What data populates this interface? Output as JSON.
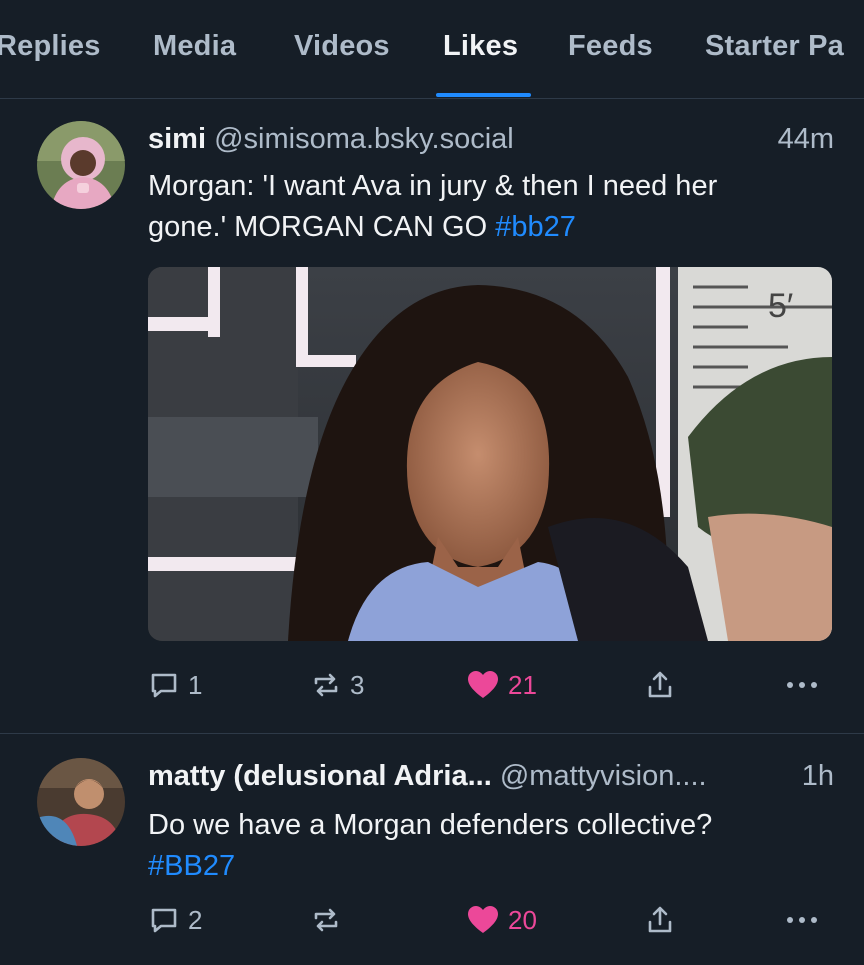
{
  "tabs": [
    {
      "label": "Replies"
    },
    {
      "label": "Media"
    },
    {
      "label": "Videos"
    },
    {
      "label": "Likes",
      "active": true
    },
    {
      "label": "Feeds"
    },
    {
      "label": "Starter Pa"
    }
  ],
  "posts": [
    {
      "display_name": "simi",
      "handle": "@simisoma.bsky.social",
      "time": "44m",
      "text_line1": "Morgan: 'I want Ava in jury & then I need her",
      "text_line2": "gone.' MORGAN CAN GO ",
      "hashtag": "#bb27",
      "has_image": true,
      "replies": "1",
      "reposts": "3",
      "likes": "21",
      "liked": true
    },
    {
      "display_name": "matty (delusional Adria...",
      "handle": "@mattyvision....",
      "time": "1h",
      "text_line1": "Do we have a Morgan defenders collective?",
      "hashtag": "#BB27",
      "replies": "2",
      "reposts": "",
      "likes": "20",
      "liked": true
    }
  ],
  "colors": {
    "background": "#161e27",
    "accent": "#208bfe",
    "like": "#ec4899",
    "muted": "#aebbc9"
  },
  "icons": [
    "reply-icon",
    "repost-icon",
    "heart-icon",
    "share-icon",
    "more-icon"
  ]
}
